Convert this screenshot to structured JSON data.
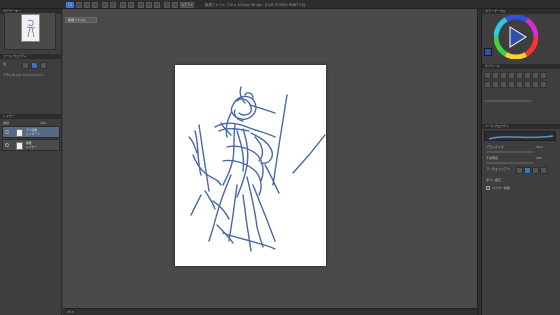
{
  "app": {
    "title": "新規ファイル 720 x 1024px 96 dpi - [CLIP STUDIO PAINT EX]"
  },
  "toolbar": {
    "buttons": [
      "CS",
      "",
      "",
      "",
      "",
      "",
      "",
      "",
      "",
      "",
      "",
      "",
      "",
      "ｴﾝﾌﾟﾘｰﾄ",
      "",
      "",
      "",
      "",
      ""
    ]
  },
  "document": {
    "tab_label": "新規ファイル"
  },
  "navigator": {
    "label": "ナビゲーター"
  },
  "left_panels": {
    "tool_property_label": "ツールプロパティ",
    "brush_label": "筆",
    "brush_size_label": "ブラシサイズ",
    "layer_panel_label": "レイヤー",
    "blend_label": "通常",
    "opacity_value": "100"
  },
  "layers": [
    {
      "name": "ラフ画像\nレイヤー 1",
      "active": true
    },
    {
      "name": "用紙\nレイヤー",
      "active": false
    }
  ],
  "right_panels": {
    "color_wheel_label": "カラーサークル",
    "sub_tool_label": "サブツール",
    "tool_settings_label": "ツールプロパティ",
    "brush_size_label": "ブラシサイズ",
    "brush_size_value": "10.0",
    "opacity_label": "不透明度",
    "opacity_value": "100",
    "anti_alias_label": "アンチエイリアス",
    "stabilization_label": "手ブレ補正",
    "vector_label": "ベクター吸着"
  },
  "colors": {
    "main": "#2f4fa8",
    "sub": "#ffffff",
    "stroke": "#3f62a0"
  },
  "status": {
    "zoom": "33.3",
    "position": ""
  }
}
